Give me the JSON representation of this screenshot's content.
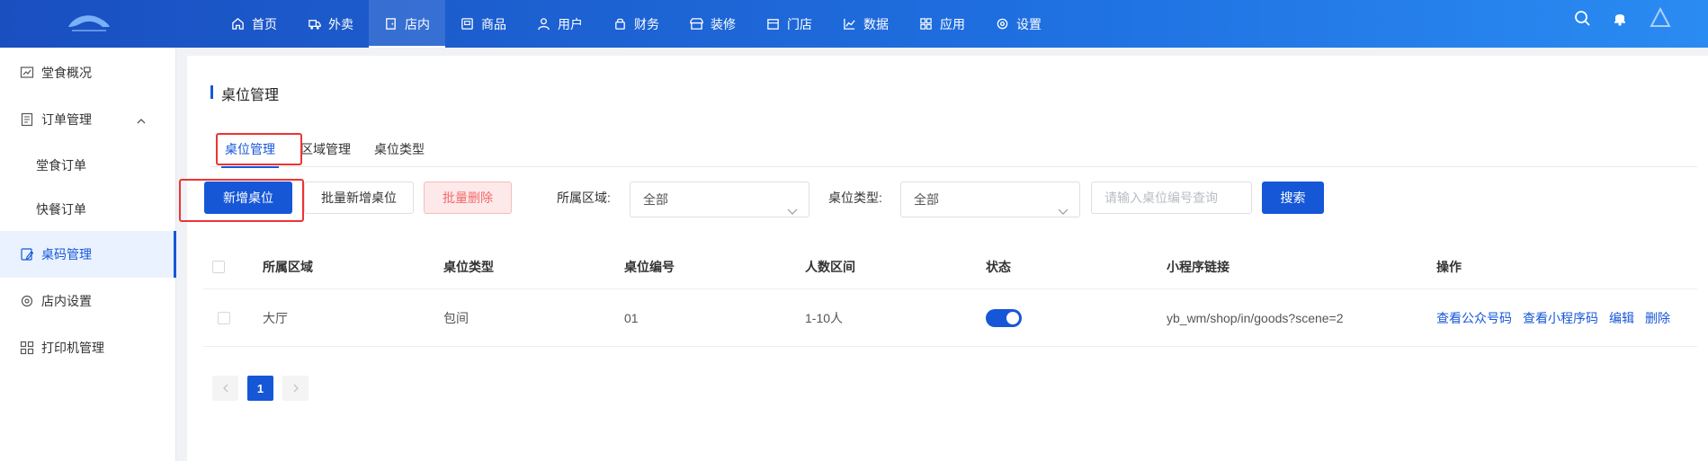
{
  "colors": {
    "primary": "#1657d8",
    "topbar": "#1f6fe0",
    "danger": "#f26a6a",
    "highlight": "#e33333"
  },
  "topnav": {
    "items": [
      {
        "label": "首页",
        "icon": "home-icon"
      },
      {
        "label": "外卖",
        "icon": "delivery-icon"
      },
      {
        "label": "店内",
        "icon": "door-icon"
      },
      {
        "label": "商品",
        "icon": "goods-icon"
      },
      {
        "label": "用户",
        "icon": "user-icon"
      },
      {
        "label": "财务",
        "icon": "finance-icon"
      },
      {
        "label": "装修",
        "icon": "shop-decor-icon"
      },
      {
        "label": "门店",
        "icon": "store-icon"
      },
      {
        "label": "数据",
        "icon": "chart-icon"
      },
      {
        "label": "应用",
        "icon": "apps-icon"
      },
      {
        "label": "设置",
        "icon": "gear-icon"
      }
    ],
    "active_index": 2
  },
  "sidebar": {
    "items": [
      {
        "label": "堂食概况",
        "icon": "overview-icon"
      },
      {
        "label": "订单管理",
        "icon": "order-icon"
      },
      {
        "label": "堂食订单"
      },
      {
        "label": "快餐订单"
      },
      {
        "label": "桌码管理",
        "icon": "qrcode-edit-icon"
      },
      {
        "label": "店内设置",
        "icon": "gear-icon"
      },
      {
        "label": "打印机管理",
        "icon": "printer-icon"
      }
    ]
  },
  "page": {
    "title": "桌位管理"
  },
  "tabs": [
    "桌位管理",
    "区域管理",
    "桌位类型"
  ],
  "toolbar": {
    "add_label": "新增桌位",
    "batch_add_label": "批量新增桌位",
    "batch_delete_label": "批量删除",
    "area_label": "所属区域:",
    "area_value": "全部",
    "type_label": "桌位类型:",
    "type_value": "全部",
    "search_placeholder": "请输入桌位编号查询",
    "search_label": "搜索"
  },
  "table": {
    "headers": [
      "所属区域",
      "桌位类型",
      "桌位编号",
      "人数区间",
      "状态",
      "小程序链接",
      "操作"
    ],
    "rows": [
      {
        "area": "大厅",
        "type": "包间",
        "number": "01",
        "capacity": "1-10人",
        "status_on": true,
        "link": "yb_wm/shop/in/goods?scene=2",
        "actions": [
          "查看公众号码",
          "查看小程序码",
          "编辑",
          "删除"
        ]
      }
    ]
  },
  "pagination": {
    "current": "1"
  }
}
